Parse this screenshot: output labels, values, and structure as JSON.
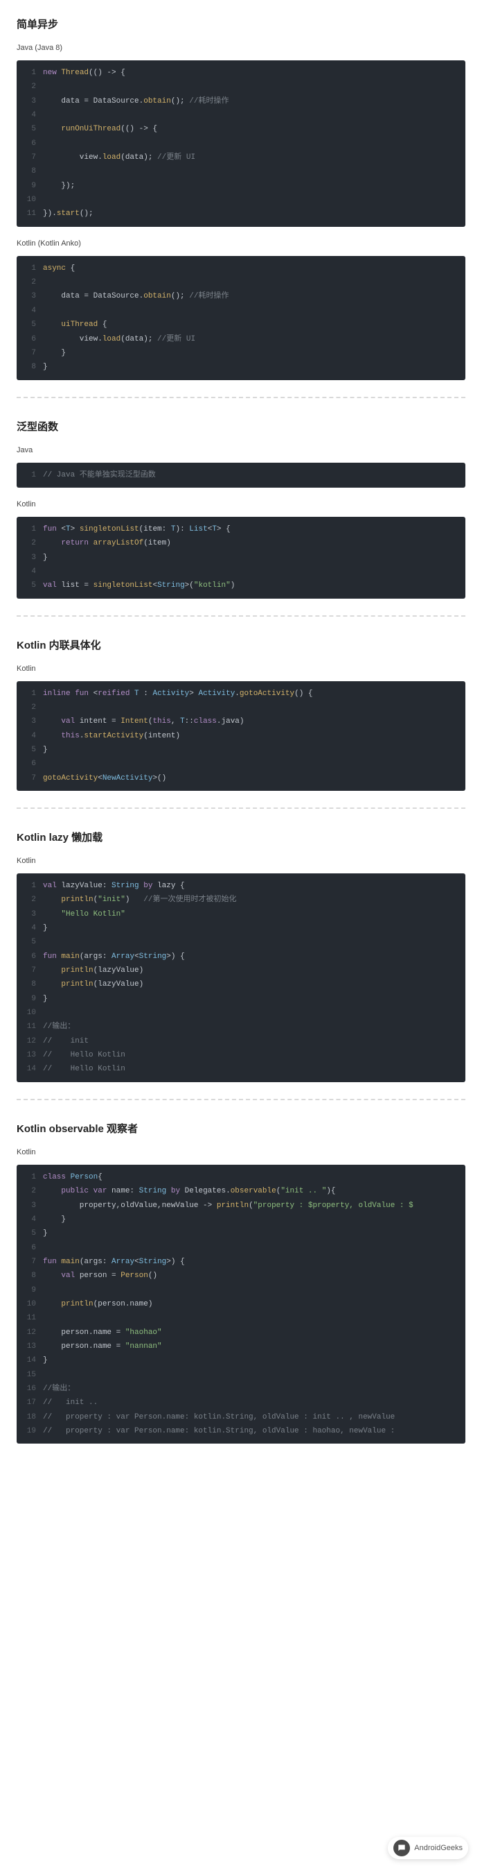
{
  "sections": [
    {
      "title": "简单异步",
      "blocks": [
        {
          "label": "Java (Java 8)",
          "code": [
            [
              [
                "kw",
                "new"
              ],
              [
                "",
                " "
              ],
              [
                "fn",
                "Thread"
              ],
              [
                "",
                "(() -> {"
              ]
            ],
            [
              [
                "",
                ""
              ]
            ],
            [
              [
                "",
                "    data = DataSource."
              ],
              [
                "fn",
                "obtain"
              ],
              [
                "",
                "(); "
              ],
              [
                "cmt",
                "//耗时操作"
              ]
            ],
            [
              [
                "",
                ""
              ]
            ],
            [
              [
                "",
                "    "
              ],
              [
                "fn",
                "runOnUiThread"
              ],
              [
                "",
                "(() -> {"
              ]
            ],
            [
              [
                "",
                ""
              ]
            ],
            [
              [
                "",
                "        view."
              ],
              [
                "fn",
                "load"
              ],
              [
                "",
                "(data); "
              ],
              [
                "cmt",
                "//更新 UI"
              ]
            ],
            [
              [
                "",
                ""
              ]
            ],
            [
              [
                "",
                "    });"
              ]
            ],
            [
              [
                "",
                ""
              ]
            ],
            [
              [
                "",
                "})."
              ],
              [
                "fn",
                "start"
              ],
              [
                "",
                "();"
              ]
            ]
          ]
        },
        {
          "label": "Kotlin (Kotlin Anko)",
          "code": [
            [
              [
                "fn",
                "async"
              ],
              [
                "",
                " {"
              ]
            ],
            [
              [
                "",
                ""
              ]
            ],
            [
              [
                "",
                "    data = DataSource."
              ],
              [
                "fn",
                "obtain"
              ],
              [
                "",
                "(); "
              ],
              [
                "cmt",
                "//耗时操作"
              ]
            ],
            [
              [
                "",
                ""
              ]
            ],
            [
              [
                "",
                "    "
              ],
              [
                "fn",
                "uiThread"
              ],
              [
                "",
                " {"
              ]
            ],
            [
              [
                "",
                "        view."
              ],
              [
                "fn",
                "load"
              ],
              [
                "",
                "(data); "
              ],
              [
                "cmt",
                "//更新 UI"
              ]
            ],
            [
              [
                "",
                "    }"
              ]
            ],
            [
              [
                "",
                "}"
              ]
            ]
          ]
        }
      ]
    },
    {
      "title": "泛型函数",
      "blocks": [
        {
          "label": "Java",
          "code": [
            [
              [
                "cmt",
                "// Java 不能单独实现泛型函数"
              ]
            ]
          ]
        },
        {
          "label": "Kotlin",
          "code": [
            [
              [
                "kw",
                "fun"
              ],
              [
                "",
                " <"
              ],
              [
                "type",
                "T"
              ],
              [
                "",
                "> "
              ],
              [
                "fn",
                "singletonList"
              ],
              [
                "",
                "(item: "
              ],
              [
                "type",
                "T"
              ],
              [
                "",
                "): "
              ],
              [
                "type",
                "List"
              ],
              [
                "",
                "<"
              ],
              [
                "type",
                "T"
              ],
              [
                "",
                "> {"
              ]
            ],
            [
              [
                "",
                "    "
              ],
              [
                "kw",
                "return"
              ],
              [
                "",
                " "
              ],
              [
                "fn",
                "arrayListOf"
              ],
              [
                "",
                "(item)"
              ]
            ],
            [
              [
                "",
                "}"
              ]
            ],
            [
              [
                "",
                ""
              ]
            ],
            [
              [
                "kw",
                "val"
              ],
              [
                "",
                " list = "
              ],
              [
                "fn",
                "singletonList"
              ],
              [
                "",
                "<"
              ],
              [
                "type",
                "String"
              ],
              [
                "",
                ">("
              ],
              [
                "str",
                "\"kotlin\""
              ],
              [
                "",
                ")"
              ]
            ]
          ]
        }
      ]
    },
    {
      "title": "Kotlin 内联具体化",
      "blocks": [
        {
          "label": "Kotlin",
          "code": [
            [
              [
                "kw",
                "inline fun"
              ],
              [
                "",
                " <"
              ],
              [
                "kw",
                "reified"
              ],
              [
                "",
                " "
              ],
              [
                "type",
                "T"
              ],
              [
                "",
                " : "
              ],
              [
                "type",
                "Activity"
              ],
              [
                "",
                "> "
              ],
              [
                "type",
                "Activity"
              ],
              [
                "",
                "."
              ],
              [
                "fn",
                "gotoActivity"
              ],
              [
                "",
                "() {"
              ]
            ],
            [
              [
                "",
                ""
              ]
            ],
            [
              [
                "",
                "    "
              ],
              [
                "kw",
                "val"
              ],
              [
                "",
                " intent = "
              ],
              [
                "fn",
                "Intent"
              ],
              [
                "",
                "("
              ],
              [
                "kw",
                "this"
              ],
              [
                "",
                ", "
              ],
              [
                "type",
                "T"
              ],
              [
                "",
                "::"
              ],
              [
                "kw",
                "class"
              ],
              [
                "",
                ".java)"
              ]
            ],
            [
              [
                "",
                "    "
              ],
              [
                "kw",
                "this"
              ],
              [
                "",
                "."
              ],
              [
                "fn",
                "startActivity"
              ],
              [
                "",
                "(intent)"
              ]
            ],
            [
              [
                "",
                "}"
              ]
            ],
            [
              [
                "",
                ""
              ]
            ],
            [
              [
                "fn",
                "gotoActivity"
              ],
              [
                "",
                "<"
              ],
              [
                "type",
                "NewActivity"
              ],
              [
                "",
                ">()"
              ]
            ]
          ]
        }
      ]
    },
    {
      "title": "Kotlin lazy 懒加载",
      "blocks": [
        {
          "label": "Kotlin",
          "code": [
            [
              [
                "kw",
                "val"
              ],
              [
                "",
                " lazyValue: "
              ],
              [
                "type",
                "String"
              ],
              [
                "",
                " "
              ],
              [
                "kw",
                "by"
              ],
              [
                "",
                " lazy {"
              ]
            ],
            [
              [
                "",
                "    "
              ],
              [
                "fn",
                "println"
              ],
              [
                "",
                "("
              ],
              [
                "str",
                "\"init\""
              ],
              [
                "",
                ")   "
              ],
              [
                "cmt",
                "//第一次使用时才被初始化"
              ]
            ],
            [
              [
                "",
                "    "
              ],
              [
                "str",
                "\"Hello Kotlin\""
              ]
            ],
            [
              [
                "",
                "}"
              ]
            ],
            [
              [
                "",
                ""
              ]
            ],
            [
              [
                "kw",
                "fun"
              ],
              [
                "",
                " "
              ],
              [
                "fn",
                "main"
              ],
              [
                "",
                "(args: "
              ],
              [
                "type",
                "Array"
              ],
              [
                "",
                "<"
              ],
              [
                "type",
                "String"
              ],
              [
                "",
                ">) {"
              ]
            ],
            [
              [
                "",
                "    "
              ],
              [
                "fn",
                "println"
              ],
              [
                "",
                "(lazyValue)"
              ]
            ],
            [
              [
                "",
                "    "
              ],
              [
                "fn",
                "println"
              ],
              [
                "",
                "(lazyValue)"
              ]
            ],
            [
              [
                "",
                "}"
              ]
            ],
            [
              [
                "",
                ""
              ]
            ],
            [
              [
                "cmt",
                "//输出："
              ]
            ],
            [
              [
                "cmt",
                "//    init"
              ]
            ],
            [
              [
                "cmt",
                "//    Hello Kotlin"
              ]
            ],
            [
              [
                "cmt",
                "//    Hello Kotlin"
              ]
            ]
          ]
        }
      ]
    },
    {
      "title": "Kotlin observable 观察者",
      "blocks": [
        {
          "label": "Kotlin",
          "code": [
            [
              [
                "kw",
                "class"
              ],
              [
                "",
                " "
              ],
              [
                "type",
                "Person"
              ],
              [
                "",
                "{"
              ]
            ],
            [
              [
                "",
                "    "
              ],
              [
                "kw",
                "public var"
              ],
              [
                "",
                " name: "
              ],
              [
                "type",
                "String"
              ],
              [
                "",
                " "
              ],
              [
                "kw",
                "by"
              ],
              [
                "",
                " Delegates."
              ],
              [
                "fn",
                "observable"
              ],
              [
                "",
                "("
              ],
              [
                "str",
                "\"init .. \""
              ],
              [
                "",
                "){"
              ]
            ],
            [
              [
                "",
                "        property,oldValue,newValue -> "
              ],
              [
                "fn",
                "println"
              ],
              [
                "",
                "("
              ],
              [
                "str",
                "\"property : $property, oldValue : $"
              ],
              [
                "",
                ""
              ]
            ],
            [
              [
                "",
                "    }"
              ]
            ],
            [
              [
                "",
                "}"
              ]
            ],
            [
              [
                "",
                ""
              ]
            ],
            [
              [
                "kw",
                "fun"
              ],
              [
                "",
                " "
              ],
              [
                "fn",
                "main"
              ],
              [
                "",
                "(args: "
              ],
              [
                "type",
                "Array"
              ],
              [
                "",
                "<"
              ],
              [
                "type",
                "String"
              ],
              [
                "",
                ">) {"
              ]
            ],
            [
              [
                "",
                "    "
              ],
              [
                "kw",
                "val"
              ],
              [
                "",
                " person = "
              ],
              [
                "fn",
                "Person"
              ],
              [
                "",
                "()"
              ]
            ],
            [
              [
                "",
                ""
              ]
            ],
            [
              [
                "",
                "    "
              ],
              [
                "fn",
                "println"
              ],
              [
                "",
                "(person.name)"
              ]
            ],
            [
              [
                "",
                ""
              ]
            ],
            [
              [
                "",
                "    person.name = "
              ],
              [
                "str",
                "\"haohao\""
              ]
            ],
            [
              [
                "",
                "    person.name = "
              ],
              [
                "str",
                "\"nannan\""
              ]
            ],
            [
              [
                "",
                "}"
              ]
            ],
            [
              [
                "",
                ""
              ]
            ],
            [
              [
                "cmt",
                "//输出："
              ]
            ],
            [
              [
                "cmt",
                "//   init .."
              ]
            ],
            [
              [
                "cmt",
                "//   property : var Person.name: kotlin.String, oldValue : init .. , newValue "
              ]
            ],
            [
              [
                "cmt",
                "//   property : var Person.name: kotlin.String, oldValue : haohao, newValue : "
              ]
            ]
          ]
        }
      ]
    }
  ],
  "floatingLabel": "AndroidGeeks"
}
